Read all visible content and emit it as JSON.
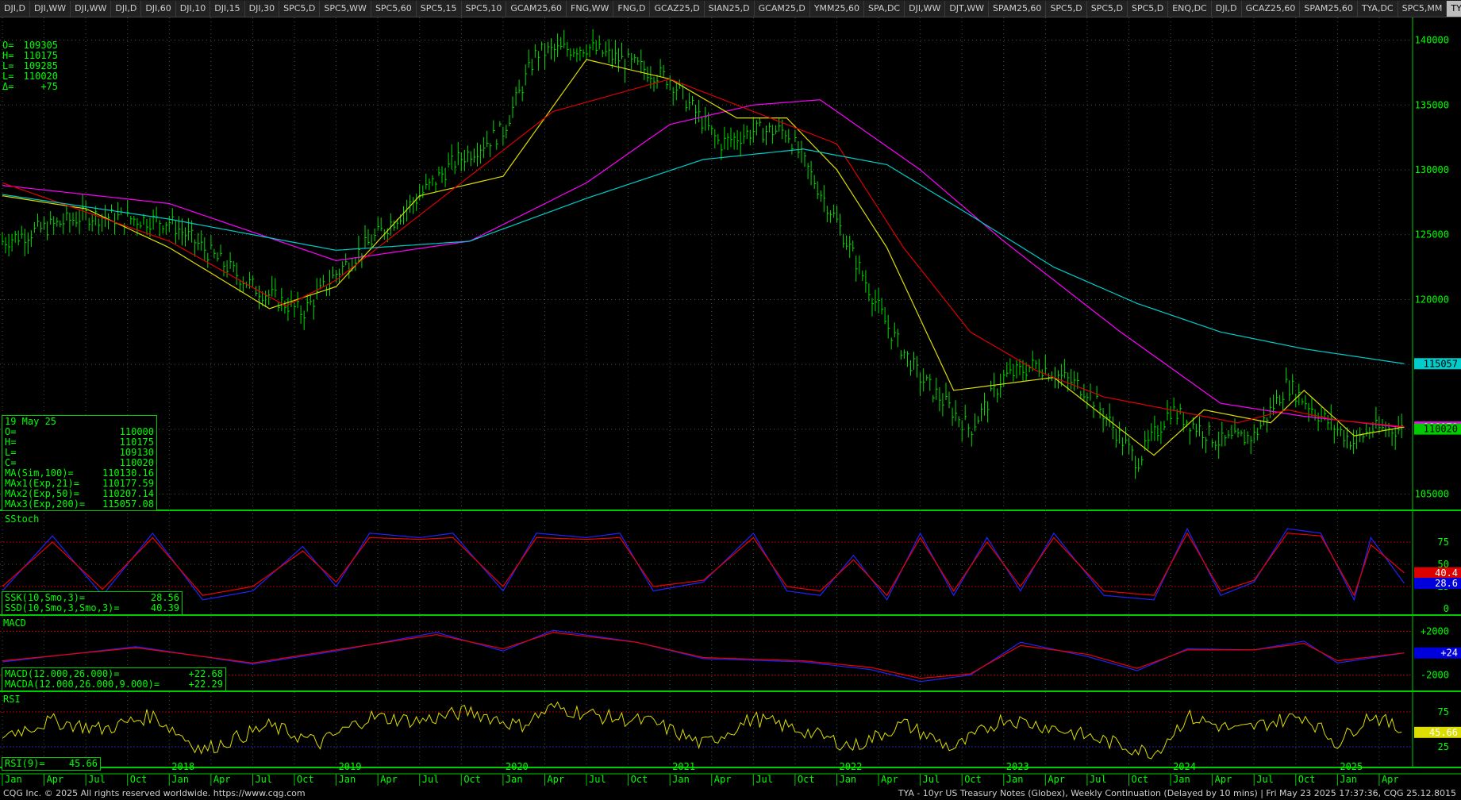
{
  "tabs": [
    "DJI,D",
    "DJI,WW",
    "DJI,WW",
    "DJI,D",
    "DJI,60",
    "DJI,10",
    "DJI,15",
    "DJI,30",
    "SPC5,D",
    "SPC5,WW",
    "SPC5,60",
    "SPC5,15",
    "SPC5,10",
    "GCAM25,60",
    "FNG,WW",
    "FNG,D",
    "GCAZ25,D",
    "SIAN25,D",
    "GCAM25,D",
    "YMM25,60",
    "SPA,DC",
    "DJI,WW",
    "DJT,WW",
    "SPAM25,60",
    "SPC5,D",
    "SPC5,D",
    "SPC5,D",
    "ENQ,DC",
    "DJI,D",
    "GCAZ25,60",
    "SPAM25,60",
    "TYA,DC",
    "SPC5,MM",
    "TYA,W",
    "+"
  ],
  "active_tab": 33,
  "ohlc_box": {
    "rows": [
      [
        "O=",
        "109305"
      ],
      [
        "H=",
        "110175"
      ],
      [
        "L=",
        "109285"
      ],
      [
        "L=",
        "110020"
      ],
      [
        "Δ=",
        "+75"
      ]
    ]
  },
  "data_window": {
    "date": "19 May 25",
    "rows": [
      [
        "O=",
        "110000"
      ],
      [
        "H=",
        "110175"
      ],
      [
        "L=",
        "109130"
      ],
      [
        "C=",
        "110020"
      ],
      [
        "MA(Sim,100)=",
        "110130.16"
      ],
      [
        "MAx1(Exp,21)=",
        "110177.59"
      ],
      [
        "MAx2(Exp,50)=",
        "110207.14"
      ],
      [
        "MAx3(Exp,200)=",
        "115057.08"
      ]
    ]
  },
  "stoch_box": {
    "rows": [
      [
        "SSK(10,Smo,3)=",
        "28.56"
      ],
      [
        "SSD(10,Smo,3,Smo,3)=",
        "40.39"
      ]
    ]
  },
  "macd_box": {
    "rows": [
      [
        "MACD(12.000,26.000)=",
        "+22.68"
      ],
      [
        "MACDA(12.000,26.000,9.000)=",
        "+22.29"
      ]
    ]
  },
  "rsi_box": {
    "rows": [
      [
        "RSI(9)=",
        "45.66"
      ]
    ]
  },
  "panel_titles": {
    "stoch": "SStoch",
    "macd": "MACD",
    "rsi": "RSI"
  },
  "price_axis": [
    "140000",
    "135000",
    "130000",
    "125000",
    "120000",
    "115000",
    "110000",
    "105000"
  ],
  "price_tags": [
    {
      "text": "115057",
      "color": "#00cccc",
      "value": 115057
    },
    {
      "text": "110170",
      "color": "#ff00ff",
      "value": 110170
    },
    {
      "text": "110020",
      "color": "#00cc00",
      "value": 110020
    }
  ],
  "stoch_axis": [
    "75",
    "50",
    "25",
    "0"
  ],
  "stoch_tags": [
    {
      "text": "40.4",
      "color": "#dd0000",
      "value": 40.4
    },
    {
      "text": "28.6",
      "color": "#0000dd",
      "value": 28.6
    }
  ],
  "macd_axis": [
    "+2000",
    "-2000"
  ],
  "macd_tags": [
    {
      "text": "+24",
      "color": "#0000dd",
      "value": 24
    }
  ],
  "rsi_axis": [
    "75",
    "25"
  ],
  "rsi_tags": [
    {
      "text": "45.66",
      "color": "#dddd00",
      "value": 45.66
    }
  ],
  "time_axis": {
    "months": [
      "Jan",
      "Apr",
      "Jul",
      "Oct",
      "Jan",
      "Apr",
      "Jul",
      "Oct",
      "Jan",
      "Apr",
      "Jul",
      "Oct",
      "Jan",
      "Apr",
      "Jul",
      "Oct",
      "Jan",
      "Apr",
      "Jul",
      "Oct",
      "Jan",
      "Apr",
      "Jul",
      "Oct",
      "Jan",
      "Apr",
      "Jul",
      "Oct",
      "Jan",
      "Apr",
      "Jul",
      "Oct",
      "Jan",
      "Apr"
    ],
    "years": [
      "2018",
      "2019",
      "2020",
      "2021",
      "2022",
      "2023",
      "2024",
      "2025"
    ]
  },
  "footer": {
    "left": "CQG Inc. © 2025 All rights reserved worldwide. https://www.cqg.com",
    "right": "TYA - 10yr US Treasury Notes (Globex), Weekly Continuation (Delayed by 10 mins) | Fri May 23 2025 17:37:36, CQG 25.12.8015"
  },
  "chart_data": {
    "type": "line",
    "x_range": [
      "2017-01",
      "2025-05"
    ],
    "price_range": [
      104000,
      141500
    ],
    "price_x": [
      2017.0,
      2017.5,
      2018.0,
      2018.5,
      2018.8,
      2019.0,
      2019.5,
      2019.7,
      2020.0,
      2020.2,
      2020.5,
      2020.7,
      2021.0,
      2021.3,
      2021.5,
      2021.7,
      2022.0,
      2022.3,
      2022.5,
      2022.8,
      2023.0,
      2023.2,
      2023.5,
      2023.8,
      2024.0,
      2024.3,
      2024.5,
      2024.7,
      2024.9,
      2025.1,
      2025.2,
      2025.4
    ],
    "price_y": [
      124500,
      126500,
      126000,
      121000,
      119000,
      122000,
      128000,
      130500,
      133000,
      139000,
      139500,
      138500,
      137000,
      132000,
      133000,
      133000,
      126000,
      118000,
      114000,
      110000,
      114000,
      115000,
      113000,
      107500,
      111500,
      109000,
      109500,
      113500,
      111000,
      109000,
      110000,
      110020
    ],
    "series": [
      {
        "name": "MA(Sim,100)",
        "color": "#ff00ff",
        "x": [
          2017.0,
          2018.0,
          2019.0,
          2019.8,
          2020.5,
          2021.0,
          2021.5,
          2021.9,
          2022.5,
          2023.0,
          2023.7,
          2024.3,
          2024.8,
          2025.4
        ],
        "y": [
          128800,
          127400,
          123000,
          124500,
          129000,
          133500,
          135000,
          135400,
          130000,
          124500,
          117500,
          112000,
          111000,
          110130
        ]
      },
      {
        "name": "MAx1(Exp,21)",
        "color": "#dddd00",
        "x": [
          2017.0,
          2017.5,
          2018.0,
          2018.6,
          2019.0,
          2019.5,
          2020.0,
          2020.5,
          2021.0,
          2021.4,
          2021.7,
          2022.0,
          2022.3,
          2022.7,
          2023.0,
          2023.3,
          2023.9,
          2024.2,
          2024.6,
          2024.8,
          2025.1,
          2025.4
        ],
        "y": [
          128000,
          127000,
          124000,
          119300,
          121000,
          128000,
          129500,
          138500,
          137000,
          134000,
          134000,
          130000,
          124000,
          113000,
          113500,
          114000,
          108000,
          111500,
          110500,
          113000,
          109500,
          110178
        ]
      },
      {
        "name": "MAx2(Exp,50)",
        "color": "#dd0000",
        "x": [
          2017.0,
          2018.0,
          2018.7,
          2019.0,
          2019.6,
          2020.3,
          2021.0,
          2021.5,
          2022.0,
          2022.4,
          2022.8,
          2023.2,
          2023.6,
          2024.0,
          2024.4,
          2024.7,
          2025.0,
          2025.4
        ],
        "y": [
          129000,
          124500,
          119500,
          121500,
          127500,
          134500,
          137000,
          134500,
          132000,
          124000,
          117500,
          114500,
          112500,
          111500,
          110500,
          111500,
          110700,
          110207
        ]
      },
      {
        "name": "MAx3(Exp,200)",
        "color": "#00cccc",
        "x": [
          2017.0,
          2018.0,
          2019.0,
          2019.8,
          2020.5,
          2021.2,
          2021.8,
          2022.3,
          2022.8,
          2023.3,
          2023.8,
          2024.3,
          2024.8,
          2025.4
        ],
        "y": [
          128100,
          126200,
          123800,
          124500,
          127800,
          130800,
          131600,
          130400,
          126500,
          122500,
          119700,
          117500,
          116200,
          115057
        ]
      }
    ],
    "stoch": {
      "range": [
        0,
        100
      ],
      "x": [
        2017.0,
        2017.3,
        2017.6,
        2017.9,
        2018.2,
        2018.5,
        2018.8,
        2019.0,
        2019.2,
        2019.5,
        2019.7,
        2020.0,
        2020.2,
        2020.5,
        2020.7,
        2020.9,
        2021.2,
        2021.5,
        2021.7,
        2021.9,
        2022.1,
        2022.3,
        2022.5,
        2022.7,
        2022.9,
        2023.1,
        2023.3,
        2023.6,
        2023.9,
        2024.1,
        2024.3,
        2024.5,
        2024.7,
        2024.9,
        2025.1,
        2025.2,
        2025.4
      ],
      "k": [
        20,
        82,
        15,
        85,
        10,
        20,
        70,
        25,
        85,
        80,
        85,
        20,
        85,
        80,
        85,
        20,
        30,
        85,
        20,
        15,
        60,
        10,
        85,
        15,
        80,
        20,
        85,
        15,
        10,
        90,
        15,
        30,
        90,
        85,
        10,
        80,
        28.6
      ],
      "d": [
        25,
        75,
        22,
        80,
        15,
        25,
        65,
        30,
        80,
        78,
        80,
        25,
        80,
        78,
        80,
        25,
        32,
        80,
        25,
        20,
        55,
        15,
        80,
        20,
        75,
        25,
        80,
        20,
        15,
        85,
        20,
        32,
        85,
        82,
        15,
        72,
        40.4
      ]
    },
    "macd": {
      "range": [
        -3200,
        3200
      ],
      "x": [
        2017.0,
        2017.8,
        2018.5,
        2019.0,
        2019.6,
        2020.0,
        2020.3,
        2020.8,
        2021.2,
        2021.8,
        2022.2,
        2022.5,
        2022.8,
        2023.1,
        2023.5,
        2023.8,
        2024.1,
        2024.5,
        2024.8,
        2025.0,
        2025.4
      ],
      "line": [
        -800,
        600,
        -1000,
        200,
        1900,
        200,
        2100,
        1000,
        -500,
        -800,
        -1500,
        -2600,
        -2000,
        1000,
        -300,
        -1600,
        400,
        300,
        1100,
        -900,
        22.68
      ],
      "signal": [
        -700,
        500,
        -900,
        300,
        1700,
        400,
        1900,
        1000,
        -400,
        -700,
        -1300,
        -2300,
        -1900,
        700,
        -100,
        -1400,
        300,
        300,
        900,
        -700,
        22.29
      ]
    },
    "rsi": {
      "range": [
        0,
        100
      ],
      "x": [
        2017.0,
        2017.3,
        2017.6,
        2017.9,
        2018.2,
        2018.6,
        2018.9,
        2019.2,
        2019.5,
        2019.8,
        2020.1,
        2020.3,
        2020.6,
        2020.9,
        2021.2,
        2021.5,
        2021.8,
        2022.1,
        2022.4,
        2022.7,
        2023.0,
        2023.3,
        2023.6,
        2023.9,
        2024.1,
        2024.4,
        2024.6,
        2024.8,
        2025.0,
        2025.2,
        2025.4
      ],
      "y": [
        42,
        62,
        50,
        70,
        20,
        55,
        30,
        68,
        62,
        76,
        55,
        82,
        68,
        60,
        28,
        66,
        48,
        25,
        58,
        22,
        66,
        52,
        34,
        15,
        68,
        48,
        60,
        70,
        30,
        72,
        45.66
      ]
    }
  }
}
